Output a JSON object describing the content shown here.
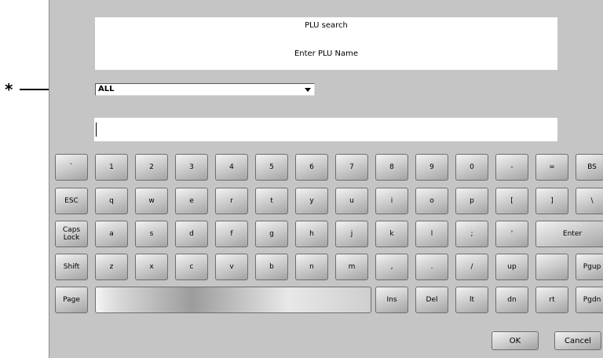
{
  "callout": {
    "marker": "*"
  },
  "header": {
    "title": "PLU search",
    "prompt": "Enter PLU Name"
  },
  "filter": {
    "selected": "ALL"
  },
  "search": {
    "value": ""
  },
  "keyboard": {
    "row1": [
      "`",
      "1",
      "2",
      "3",
      "4",
      "5",
      "6",
      "7",
      "8",
      "9",
      "0",
      "-",
      "=",
      "BS"
    ],
    "row2": [
      "ESC",
      "q",
      "w",
      "e",
      "r",
      "t",
      "y",
      "u",
      "i",
      "o",
      "p",
      "[",
      "]",
      "\\"
    ],
    "row3_keys": [
      "Caps\nLock",
      "a",
      "s",
      "d",
      "f",
      "g",
      "h",
      "j",
      "k",
      "l",
      ";",
      "'"
    ],
    "enter": "Enter",
    "row4": [
      "Shift",
      "z",
      "x",
      "c",
      "v",
      "b",
      "n",
      "m",
      ",",
      ".",
      "/",
      "up",
      "",
      "Pgup"
    ],
    "row5_left": "Page",
    "row5_space": "",
    "row5_right": [
      "Ins",
      "Del",
      "lt",
      "dn",
      "rt",
      "Pgdn"
    ]
  },
  "actions": {
    "ok": "OK",
    "cancel": "Cancel"
  }
}
